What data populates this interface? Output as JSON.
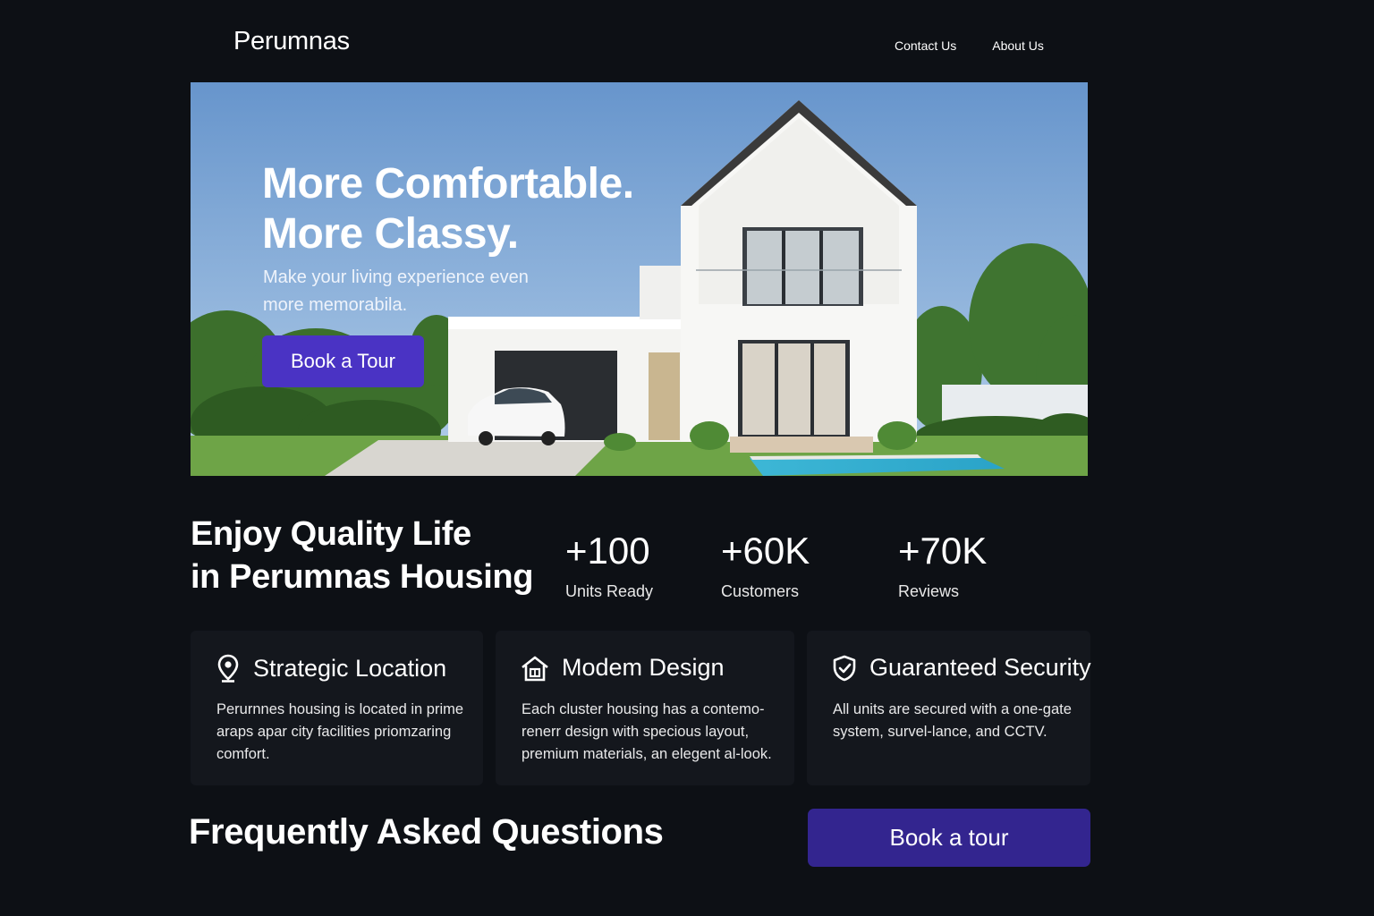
{
  "header": {
    "logo": "Perumnas",
    "nav": [
      "Contact Us",
      "About Us"
    ]
  },
  "hero": {
    "title": "More Comfortable.\nMore Classy.",
    "subtitle": "Make your living experience even more memorabila.",
    "cta": "Book a Tour"
  },
  "quality": {
    "heading": "Enjoy Quality Life\nin Perumnas Housing"
  },
  "stats": [
    {
      "value": "+100",
      "label": "Units Ready"
    },
    {
      "value": "+60K",
      "label": "Customers"
    },
    {
      "value": "+70K",
      "label": "Reviews"
    }
  ],
  "features": [
    {
      "icon": "location-pin-icon",
      "title": "Strategic Location",
      "text": "Perurnnes housing is located in prime araps apar city facilities priomzaring comfort."
    },
    {
      "icon": "house-icon",
      "title": "Modem Design",
      "text": "Each cluster housing has a contemo-renerr design with specious layout, premium materials, an elegent al-look."
    },
    {
      "icon": "shield-check-icon",
      "title": "Guaranteed Security",
      "text": "All units are secured with a one-gate system, survel-lance, and CCTV."
    }
  ],
  "faq": {
    "heading": "Frequently Asked Questions",
    "cta": "Book a tour"
  },
  "colors": {
    "background": "#0d1015",
    "card": "#14171d",
    "primary_button": "#4a33c4",
    "secondary_button": "#33258f"
  }
}
